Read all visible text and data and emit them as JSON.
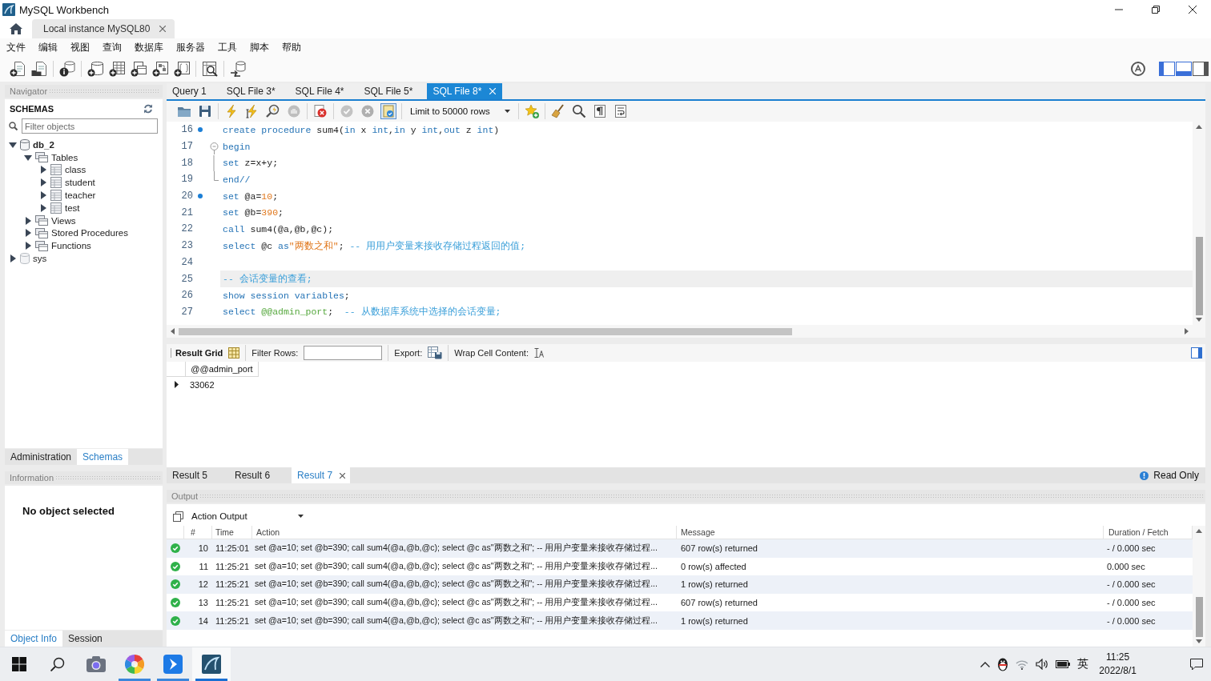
{
  "window": {
    "title": "MySQL Workbench"
  },
  "connection_tabs": [
    {
      "label": "Local instance MySQL80",
      "selected": true
    }
  ],
  "menu": [
    "文件",
    "编辑",
    "视图",
    "查询",
    "数据库",
    "服务器",
    "工具",
    "脚本",
    "帮助"
  ],
  "panel_toggles": [
    {
      "on": true
    },
    {
      "on": true
    },
    {
      "on": false
    }
  ],
  "navigator": {
    "title": "Navigator",
    "section": "SCHEMAS",
    "filter": {
      "placeholder": "Filter objects"
    },
    "tree": [
      {
        "label": "db_2",
        "kind": "schema",
        "default": true,
        "expanded": true,
        "children": [
          {
            "label": "Tables",
            "kind": "group",
            "expanded": true,
            "children": [
              {
                "label": "class",
                "kind": "table",
                "expanded": false
              },
              {
                "label": "student",
                "kind": "table",
                "expanded": false
              },
              {
                "label": "teacher",
                "kind": "table",
                "expanded": false
              },
              {
                "label": "test",
                "kind": "table",
                "expanded": false
              }
            ]
          },
          {
            "label": "Views",
            "kind": "group",
            "expanded": false
          },
          {
            "label": "Stored Procedures",
            "kind": "group",
            "expanded": false
          },
          {
            "label": "Functions",
            "kind": "group",
            "expanded": false
          }
        ]
      },
      {
        "label": "sys",
        "kind": "schema",
        "default": false,
        "expanded": false
      }
    ]
  },
  "navigator_tabs": [
    {
      "label": "Administration",
      "selected": false
    },
    {
      "label": "Schemas",
      "selected": true
    }
  ],
  "information": {
    "title": "Information",
    "message": "No object selected"
  },
  "information_tabs": [
    {
      "label": "Object Info",
      "selected": true
    },
    {
      "label": "Session",
      "selected": false
    }
  ],
  "editor_tabs": [
    {
      "label": "Query 1",
      "selected": false
    },
    {
      "label": "SQL File 3*",
      "selected": false
    },
    {
      "label": "SQL File 4*",
      "selected": false
    },
    {
      "label": "SQL File 5*",
      "selected": false
    },
    {
      "label": "SQL File 8*",
      "selected": true
    }
  ],
  "editor_toolbar": {
    "buttons": [
      {
        "disabled": false,
        "pressed": false
      },
      {
        "disabled": false,
        "pressed": false
      },
      {
        "disabled": false,
        "pressed": false
      },
      {
        "disabled": false,
        "pressed": false
      },
      {
        "disabled": false,
        "pressed": false
      },
      {
        "disabled": true,
        "pressed": false
      },
      {
        "disabled": false,
        "pressed": false
      },
      {
        "disabled": true,
        "pressed": false
      },
      {
        "disabled": true,
        "pressed": false
      },
      {
        "disabled": false,
        "pressed": true
      },
      {
        "disabled": false,
        "pressed": false
      },
      {
        "disabled": false,
        "pressed": false
      },
      {
        "disabled": false,
        "pressed": false
      },
      {
        "disabled": false,
        "pressed": false
      },
      {
        "disabled": false,
        "pressed": false
      }
    ],
    "limit": "Limit to 50000 rows"
  },
  "code_lines": [
    {
      "number": "16",
      "marker": true,
      "current": false,
      "tokens": [
        {
          "kind": "keyword",
          "text": "create procedure"
        },
        {
          "kind": "plain",
          "text": " sum4("
        },
        {
          "kind": "keyword",
          "text": "in"
        },
        {
          "kind": "plain",
          "text": " x "
        },
        {
          "kind": "keyword",
          "text": "int"
        },
        {
          "kind": "plain",
          "text": ","
        },
        {
          "kind": "keyword",
          "text": "in"
        },
        {
          "kind": "plain",
          "text": " y "
        },
        {
          "kind": "keyword",
          "text": "int"
        },
        {
          "kind": "plain",
          "text": ","
        },
        {
          "kind": "keyword",
          "text": "out"
        },
        {
          "kind": "plain",
          "text": " z "
        },
        {
          "kind": "keyword",
          "text": "int"
        },
        {
          "kind": "plain",
          "text": ")"
        }
      ]
    },
    {
      "number": "17",
      "marker": false,
      "current": false,
      "expanded": true,
      "tokens": [
        {
          "kind": "keyword",
          "text": "begin"
        }
      ],
      "children": [
        {
          "number": "18",
          "marker": false,
          "current": false,
          "tokens": [
            {
              "kind": "keyword",
              "text": "set"
            },
            {
              "kind": "plain",
              "text": " z=x+y;"
            }
          ]
        },
        {
          "number": "19",
          "marker": false,
          "current": false,
          "tokens": [
            {
              "kind": "keyword",
              "text": "end//"
            }
          ]
        }
      ]
    },
    {
      "number": "20",
      "marker": true,
      "current": false,
      "tokens": [
        {
          "kind": "keyword",
          "text": "set"
        },
        {
          "kind": "plain",
          "text": " @a="
        },
        {
          "kind": "number",
          "text": "10"
        },
        {
          "kind": "plain",
          "text": ";"
        }
      ]
    },
    {
      "number": "21",
      "marker": false,
      "current": false,
      "tokens": [
        {
          "kind": "keyword",
          "text": "set"
        },
        {
          "kind": "plain",
          "text": " @b="
        },
        {
          "kind": "number",
          "text": "390"
        },
        {
          "kind": "plain",
          "text": ";"
        }
      ]
    },
    {
      "number": "22",
      "marker": false,
      "current": false,
      "tokens": [
        {
          "kind": "keyword",
          "text": "call"
        },
        {
          "kind": "plain",
          "text": " sum4(@a,@b,@c);"
        }
      ]
    },
    {
      "number": "23",
      "marker": false,
      "current": false,
      "tokens": [
        {
          "kind": "keyword",
          "text": "select"
        },
        {
          "kind": "plain",
          "text": " @c "
        },
        {
          "kind": "keyword",
          "text": "as"
        },
        {
          "kind": "string",
          "text": "\"两数之和\""
        },
        {
          "kind": "plain",
          "text": "; "
        },
        {
          "kind": "comment",
          "text": "-- 用用户变量来接收存储过程返回的值;"
        }
      ]
    },
    {
      "number": "24",
      "marker": false,
      "current": false
    },
    {
      "number": "25",
      "marker": false,
      "current": true,
      "tokens": [
        {
          "kind": "comment",
          "text": "-- 会话变量的查看;"
        }
      ]
    },
    {
      "number": "26",
      "marker": false,
      "current": false,
      "tokens": [
        {
          "kind": "keyword",
          "text": "show session variables"
        },
        {
          "kind": "plain",
          "text": ";"
        }
      ]
    },
    {
      "number": "27",
      "marker": false,
      "current": false,
      "tokens": [
        {
          "kind": "keyword",
          "text": "select"
        },
        {
          "kind": "variable",
          "text": " @@admin_port"
        },
        {
          "kind": "plain",
          "text": ";  "
        },
        {
          "kind": "comment",
          "text": "-- 从数据库系统中选择的会话变量;"
        }
      ]
    }
  ],
  "result_toolbar": {
    "view": "Result Grid",
    "filter_label": "Filter Rows:",
    "export_label": "Export:",
    "wrap_label": "Wrap Cell Content:"
  },
  "result_grid": {
    "columns": [
      "@@admin_port"
    ],
    "rows": [
      {
        "current": true,
        "cells": [
          "33062"
        ]
      }
    ]
  },
  "result_tabs": [
    {
      "label": "Result 5",
      "selected": false
    },
    {
      "label": "Result 6",
      "selected": false
    },
    {
      "label": "Result 7",
      "selected": true
    }
  ],
  "result_status": "Read Only",
  "output": {
    "title": "Output",
    "mode": "Action Output",
    "columns": [
      "#",
      "Time",
      "Action",
      "Message",
      "Duration / Fetch"
    ],
    "rows": [
      {
        "kind": "success",
        "number": "10",
        "time": "11:25:01",
        "action": "set @a=10; set @b=390; call sum4(@a,@b,@c); select @c as\"两数之和\"; -- 用用户变量来接收存储过程...",
        "message": "607 row(s) returned",
        "duration": "- / 0.000 sec"
      },
      {
        "kind": "success",
        "number": "11",
        "time": "11:25:21",
        "action": "set @a=10; set @b=390; call sum4(@a,@b,@c); select @c as\"两数之和\"; -- 用用户变量来接收存储过程...",
        "message": "0 row(s) affected",
        "duration": "0.000 sec"
      },
      {
        "kind": "success",
        "number": "12",
        "time": "11:25:21",
        "action": "set @a=10; set @b=390; call sum4(@a,@b,@c); select @c as\"两数之和\"; -- 用用户变量来接收存储过程...",
        "message": "1 row(s) returned",
        "duration": "- / 0.000 sec"
      },
      {
        "kind": "success",
        "number": "13",
        "time": "11:25:21",
        "action": "set @a=10; set @b=390; call sum4(@a,@b,@c); select @c as\"两数之和\"; -- 用用户变量来接收存储过程...",
        "message": "607 row(s) returned",
        "duration": "- / 0.000 sec"
      },
      {
        "kind": "success",
        "number": "14",
        "time": "11:25:21",
        "action": "set @a=10; set @b=390; call sum4(@a,@b,@c); select @c as\"两数之和\"; -- 用用户变量来接收存储过程...",
        "message": "1 row(s) returned",
        "duration": "- / 0.000 sec"
      }
    ]
  },
  "taskbar": {
    "apps": [
      {
        "running": false,
        "active": false
      },
      {
        "running": true,
        "active": false
      },
      {
        "running": true,
        "active": false
      },
      {
        "running": true,
        "active": true
      }
    ],
    "input_method": "英",
    "time": "11:25",
    "date": "2022/8/1"
  }
}
